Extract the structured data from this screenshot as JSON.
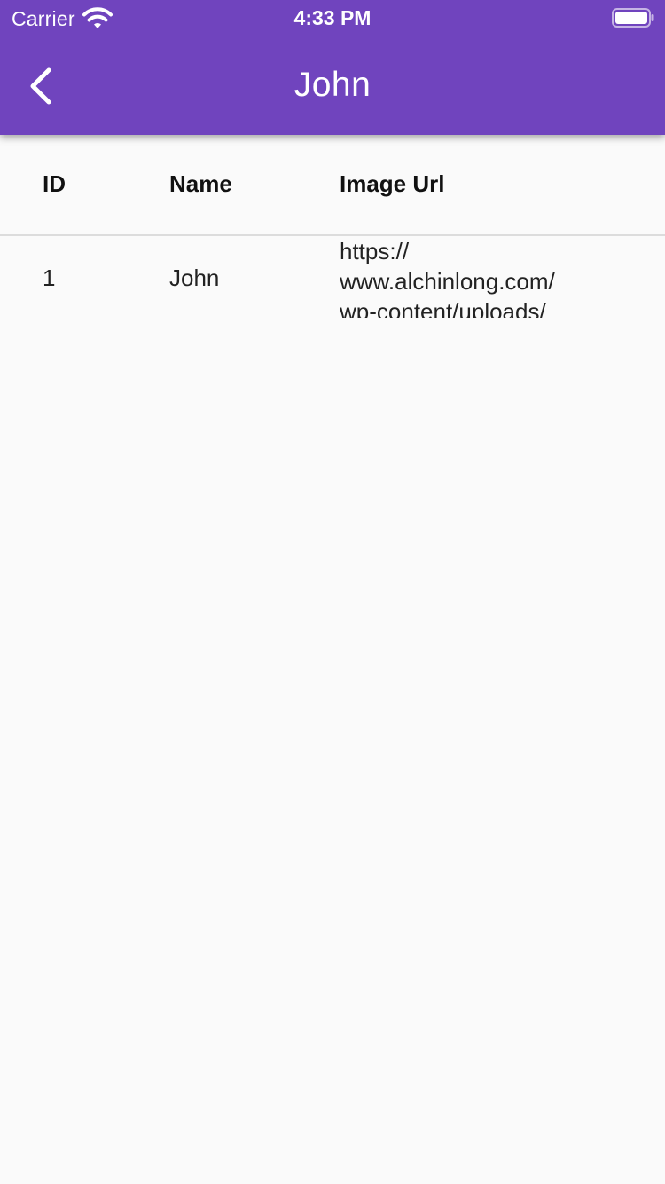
{
  "status_bar": {
    "carrier": "Carrier",
    "time": "4:33 PM"
  },
  "app_bar": {
    "title": "John",
    "background_color": "#7044be",
    "back_icon": "chevron-left-icon"
  },
  "table": {
    "columns": [
      "ID",
      "Name",
      "Image Url"
    ],
    "rows": [
      {
        "id": "1",
        "name": "John",
        "image_url": "https://\nwww.alchinlong.com/\nwp-content/uploads/"
      }
    ]
  }
}
